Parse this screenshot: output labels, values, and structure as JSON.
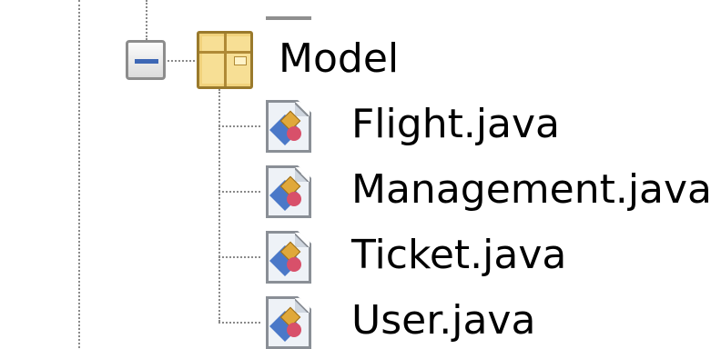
{
  "tree": {
    "folder": {
      "label": "Model",
      "expanded": true,
      "icon": "package-icon",
      "expander_icon": "collapse-minus-icon"
    },
    "files": [
      {
        "label": "Flight.java",
        "icon": "java-file-icon"
      },
      {
        "label": "Management.java",
        "icon": "java-file-icon"
      },
      {
        "label": "Ticket.java",
        "icon": "java-file-icon"
      },
      {
        "label": "User.java",
        "icon": "java-file-icon"
      }
    ]
  },
  "colors": {
    "package_fill": "#f1d27c",
    "expander_minus": "#3d67b5",
    "tree_lines": "#8a8a8a"
  }
}
